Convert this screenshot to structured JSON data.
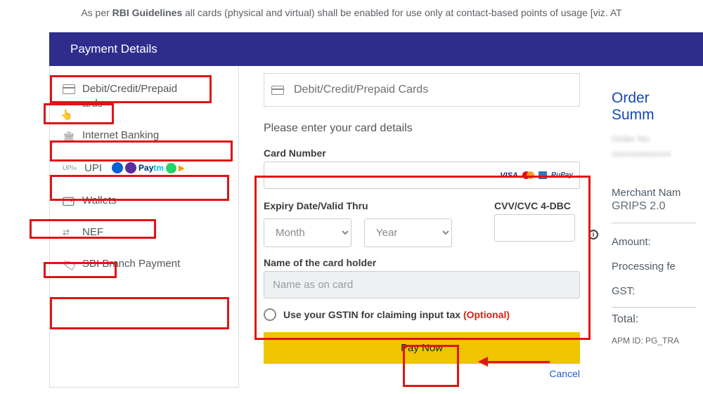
{
  "topNotice": {
    "prefix": "As per ",
    "bold": "RBI Guidelines",
    "rest": " all cards (physical and virtual) shall be enabled for use only at contact-based points of usage [viz. AT"
  },
  "header": "Payment Details",
  "sidebar": {
    "items": [
      {
        "label_line1": "Debit/Credit/Prepaid",
        "label_line2": "ards"
      },
      {
        "label": "Internet Banking"
      },
      {
        "label": "UPI"
      },
      {
        "label": "Wallets"
      },
      {
        "label": "NEF"
      },
      {
        "label": "SBI Branch Payment"
      }
    ]
  },
  "panel": {
    "title": "Debit/Credit/Prepaid Cards",
    "instruction": "Please enter your card details",
    "cardNumberLabel": "Card Number",
    "expiryLabel": "Expiry Date/Valid Thru",
    "monthPlaceholder": "Month",
    "yearPlaceholder": "Year",
    "cvvLabel": "CVV/CVC 4-DBC",
    "nameLabel": "Name of the card holder",
    "namePlaceholder": "Name as on card",
    "gstinText": "Use your GSTIN for claiming input tax",
    "gstinOptional": "(Optional)",
    "payButton": "Pay Now",
    "cancel": "Cancel",
    "networks": {
      "visa": "VISA",
      "rupay": "RuPay"
    }
  },
  "summary": {
    "title": "Order Summ",
    "blur1": "Order No",
    "blur2": "xxxxxxxxxxxxx",
    "merchantLabel": "Merchant Nam",
    "merchantValue": "GRIPS 2.0",
    "amountLabel": "Amount:",
    "processingLabel": "Processing fe",
    "gstLabel": "GST:",
    "totalLabel": "Total:",
    "apmLabel": "APM ID: PG_TRA"
  }
}
